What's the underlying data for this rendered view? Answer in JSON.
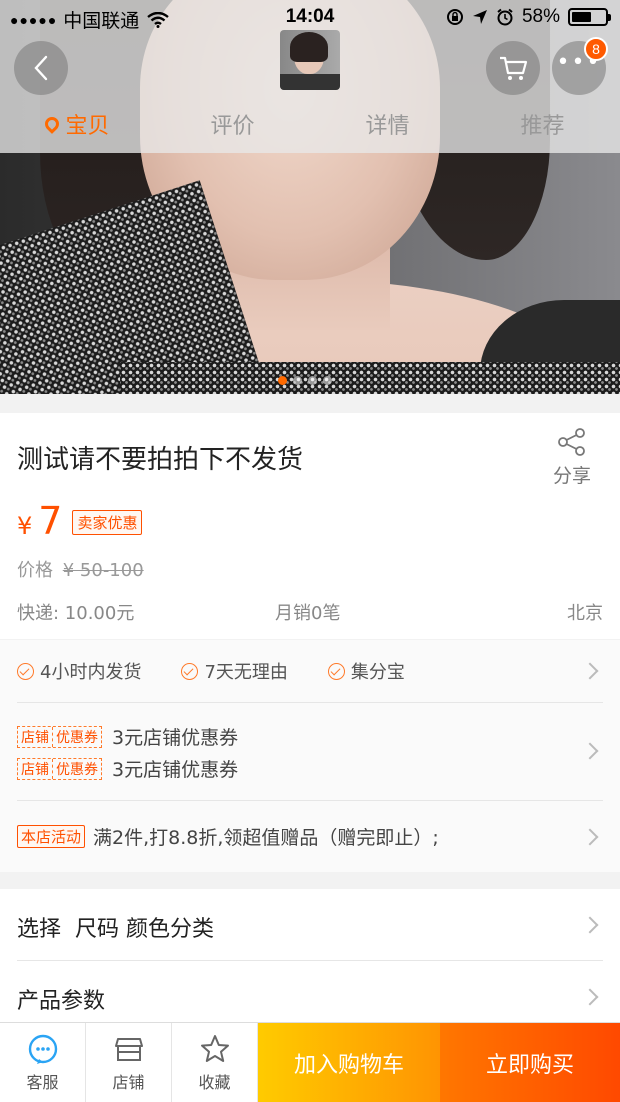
{
  "status_bar": {
    "signal_dots": "●●●●●",
    "carrier": "中国联通",
    "time": "14:04",
    "battery": "58%",
    "battery_level": 0.58
  },
  "nav": {
    "cart_badge": "8",
    "tabs": [
      {
        "label": "宝贝",
        "active": true
      },
      {
        "label": "评价",
        "active": false
      },
      {
        "label": "详情",
        "active": false
      },
      {
        "label": "推荐",
        "active": false
      }
    ]
  },
  "carousel": {
    "slides": 4,
    "active_index": 0
  },
  "product": {
    "title": "测试请不要拍拍下不发货",
    "share_label": "分享",
    "currency": "¥",
    "price": "7",
    "price_tag": "卖家优惠",
    "orig_price_label": "价格",
    "orig_price": "¥ 50-100",
    "shipping": "快递: 10.00元",
    "sales": "月销0笔",
    "location": "北京"
  },
  "services": {
    "items": [
      "4小时内发货",
      "7天无理由",
      "集分宝"
    ],
    "coupons": [
      {
        "tag_left": "店铺",
        "tag_right": "优惠券",
        "text": "3元店铺优惠券"
      },
      {
        "tag_left": "店铺",
        "tag_right": "优惠券",
        "text": "3元店铺优惠券"
      }
    ],
    "activity_tag": "本店活动",
    "activity_text": "满2件,打8.8折,领超值赠品（赠完即止）;"
  },
  "options": {
    "select_label": "选择  尺码 颜色分类",
    "params_label": "产品参数"
  },
  "bottom_bar": {
    "service": "客服",
    "shop": "店铺",
    "favorite": "收藏",
    "add_to_cart": "加入购物车",
    "buy_now": "立即购买"
  },
  "colors": {
    "accent": "#ff5000",
    "cart_button": "#ffa200",
    "buy_button": "#ff5a00"
  }
}
